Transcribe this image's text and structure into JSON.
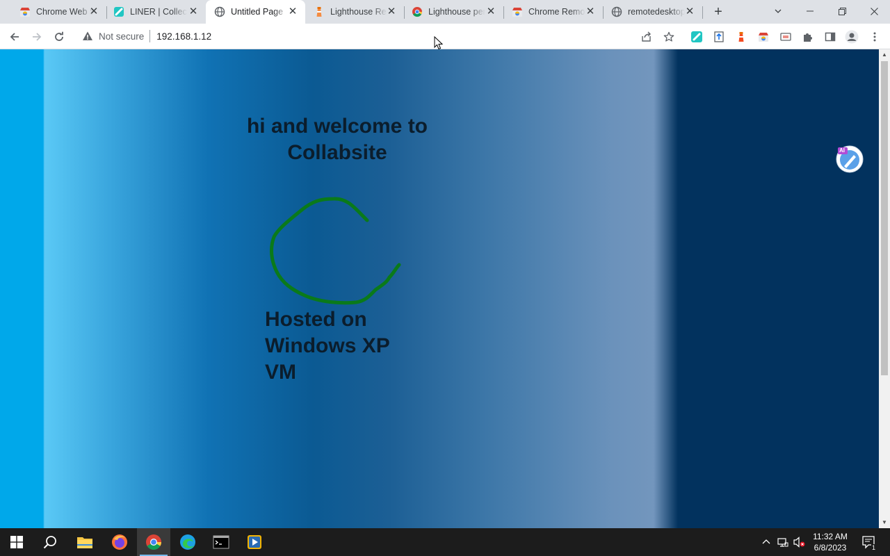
{
  "browser": {
    "tabs": [
      {
        "title": "Chrome Web Store",
        "icon": "chrome-webstore-icon",
        "active": false
      },
      {
        "title": "LINER | Collect",
        "icon": "liner-icon",
        "active": false
      },
      {
        "title": "Untitled Page",
        "icon": "globe-icon",
        "active": true
      },
      {
        "title": "Lighthouse Report",
        "icon": "lighthouse-icon",
        "active": false
      },
      {
        "title": "Lighthouse performance",
        "icon": "google-chrome-icon",
        "active": false
      },
      {
        "title": "Chrome Remote Desktop",
        "icon": "chrome-remote-icon",
        "active": false
      },
      {
        "title": "remotedesktop",
        "icon": "globe-icon",
        "active": false
      }
    ],
    "new_tab_label": "+",
    "address_bar": {
      "security_label": "Not secure",
      "url": "192.168.1.12"
    }
  },
  "page": {
    "heading_line1": "hi and welcome to",
    "heading_line2": "Collabsite",
    "hosted_line1": "Hosted on",
    "hosted_line2": "Windows XP",
    "hosted_line3": "VM",
    "ai_badge": "AI",
    "colors": {
      "light_blue": "#00a8ea",
      "dark_navy": "#02325e",
      "scribble_green": "#0a7a1a"
    }
  },
  "taskbar": {
    "apps": [
      "windows-start",
      "search",
      "file-explorer",
      "firefox",
      "google-chrome",
      "microsoft-edge",
      "terminal",
      "media-player"
    ],
    "clock_time": "11:32 AM",
    "clock_date": "6/8/2023",
    "notification_count": "1"
  }
}
